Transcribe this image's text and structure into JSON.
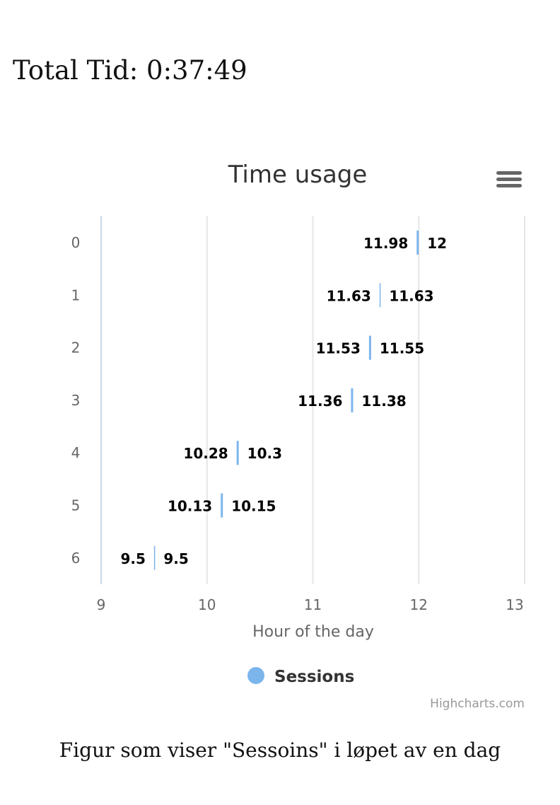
{
  "header": {
    "total_time": "Total Tid: 0:37:49"
  },
  "caption": "Figur som viser \"Sessoins\" i løpet av en dag",
  "chart_data": {
    "type": "columnrange",
    "inverted": true,
    "title": "Time usage",
    "xlabel": "Hour of the day",
    "categories": [
      "0",
      "1",
      "2",
      "3",
      "4",
      "5",
      "6"
    ],
    "series": [
      {
        "name": "Sessions",
        "color": "#7cb5ec",
        "ranges": [
          [
            11.98,
            12
          ],
          [
            11.63,
            11.63
          ],
          [
            11.53,
            11.55
          ],
          [
            11.36,
            11.38
          ],
          [
            10.28,
            10.3
          ],
          [
            10.13,
            10.15
          ],
          [
            9.5,
            9.5
          ]
        ]
      }
    ],
    "axis_range": [
      9,
      13
    ],
    "ticks": [
      "9",
      "10",
      "11",
      "12",
      "13"
    ],
    "grid": true,
    "legend": "bottom-center",
    "credits": "Highcharts.com"
  }
}
